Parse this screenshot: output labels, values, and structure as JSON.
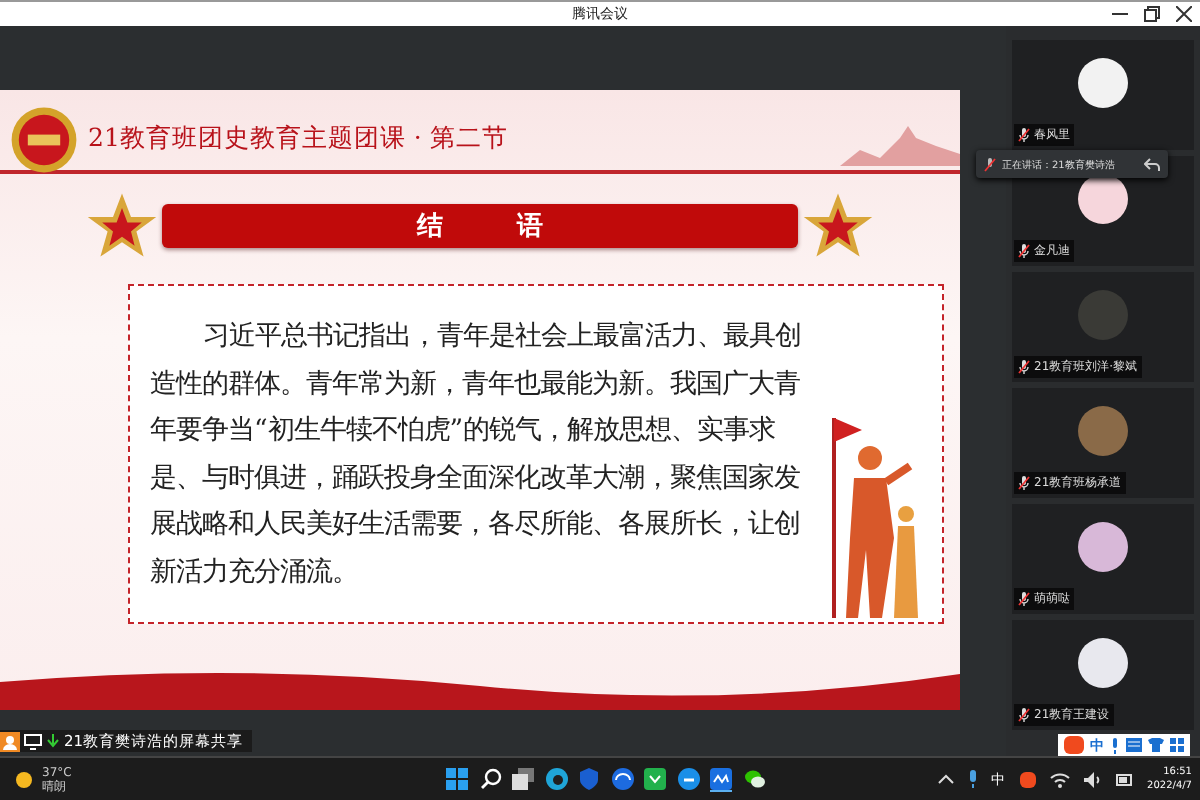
{
  "window": {
    "title": "腾讯会议"
  },
  "slide": {
    "header": "21教育班团史教育主题团课 · 第二节",
    "banner": "结 语",
    "paragraph": "习近平总书记指出，青年是社会上最富活力、最具创造性的群体。青年常为新，青年也最能为新。我国广大青年要争当“初生牛犊不怕虎”的锐气，解放思想、实事求是、与时俱进，踊跃投身全面深化改革大潮，聚焦国家发展战略和人民美好生活需要，各尽所能、各展所长，让创新活力充分涌流。"
  },
  "speaking_tooltip": {
    "text": "正在讲话：21教育樊诗浩"
  },
  "participants": [
    {
      "name": "春风里",
      "muted": true,
      "color": "#f2f2f2"
    },
    {
      "name": "金凡迪",
      "muted": true,
      "color": "#f6d6dc"
    },
    {
      "name": "21教育班刘洋·黎斌",
      "muted": true,
      "color": "#3a3a36"
    },
    {
      "name": "21教育班杨承道",
      "muted": true,
      "color": "#8a6a48"
    },
    {
      "name": "萌萌哒",
      "muted": true,
      "color": "#d8b8d8"
    },
    {
      "name": "21教育王建设",
      "muted": true,
      "color": "#e8e8ee"
    }
  ],
  "share_bar": {
    "label": "21教育樊诗浩的屏幕共享"
  },
  "ime_bar": {
    "label": "中"
  },
  "taskbar": {
    "temperature": "37°C",
    "weather": "晴朗",
    "ime": "中",
    "time": "16:51",
    "date": "2022/4/7"
  }
}
